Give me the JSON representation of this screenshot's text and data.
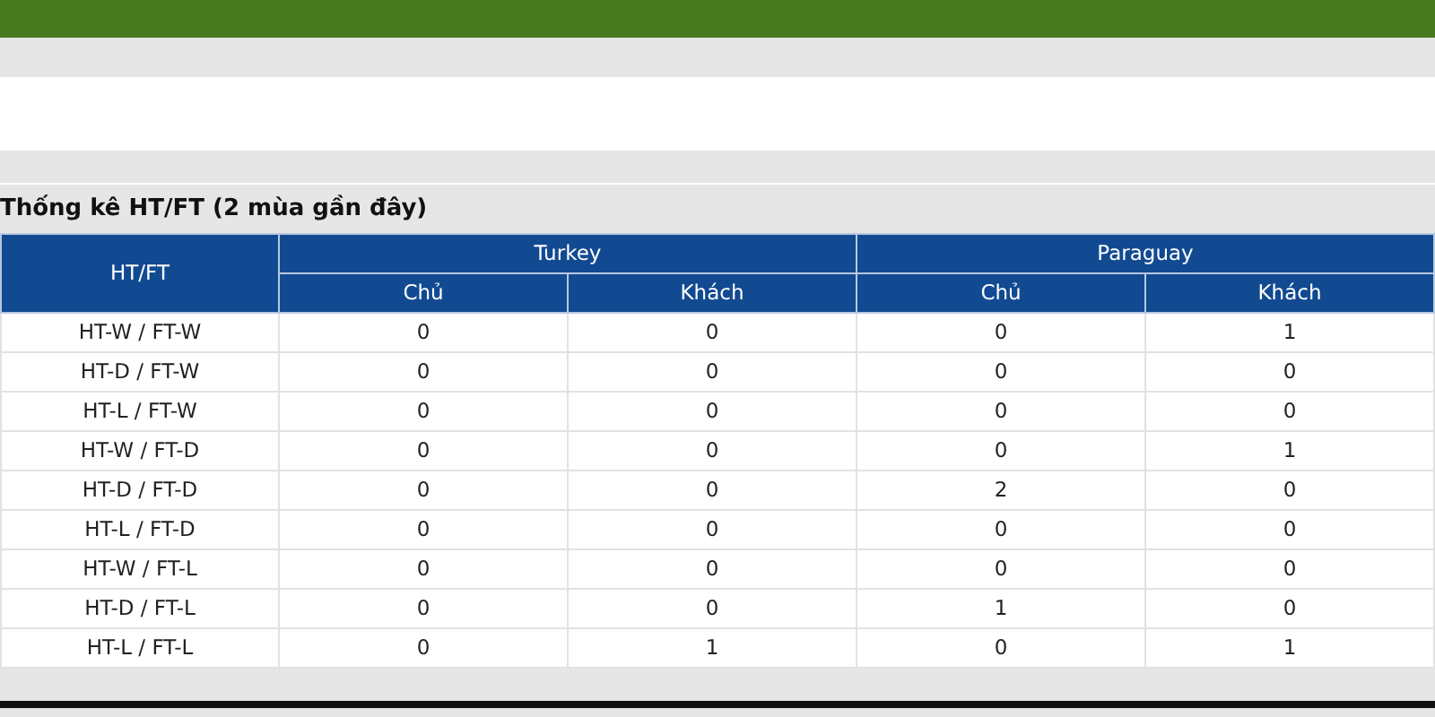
{
  "title": "Thống kê HT/FT (2 mùa gần đây)",
  "table": {
    "first_column": "HT/FT",
    "teams": [
      {
        "name": "Turkey",
        "columns": [
          "Chủ",
          "Khách"
        ]
      },
      {
        "name": "Paraguay",
        "columns": [
          "Chủ",
          "Khách"
        ]
      }
    ],
    "rows": [
      {
        "label": "HT-W / FT-W",
        "values": [
          "0",
          "0",
          "0",
          "1"
        ]
      },
      {
        "label": "HT-D / FT-W",
        "values": [
          "0",
          "0",
          "0",
          "0"
        ]
      },
      {
        "label": "HT-L / FT-W",
        "values": [
          "0",
          "0",
          "0",
          "0"
        ]
      },
      {
        "label": "HT-W / FT-D",
        "values": [
          "0",
          "0",
          "0",
          "1"
        ]
      },
      {
        "label": "HT-D / FT-D",
        "values": [
          "0",
          "0",
          "2",
          "0"
        ]
      },
      {
        "label": "HT-L / FT-D",
        "values": [
          "0",
          "0",
          "0",
          "0"
        ]
      },
      {
        "label": "HT-W / FT-L",
        "values": [
          "0",
          "0",
          "0",
          "0"
        ]
      },
      {
        "label": "HT-D / FT-L",
        "values": [
          "0",
          "0",
          "1",
          "0"
        ]
      },
      {
        "label": "HT-L / FT-L",
        "values": [
          "0",
          "1",
          "0",
          "1"
        ]
      }
    ]
  }
}
